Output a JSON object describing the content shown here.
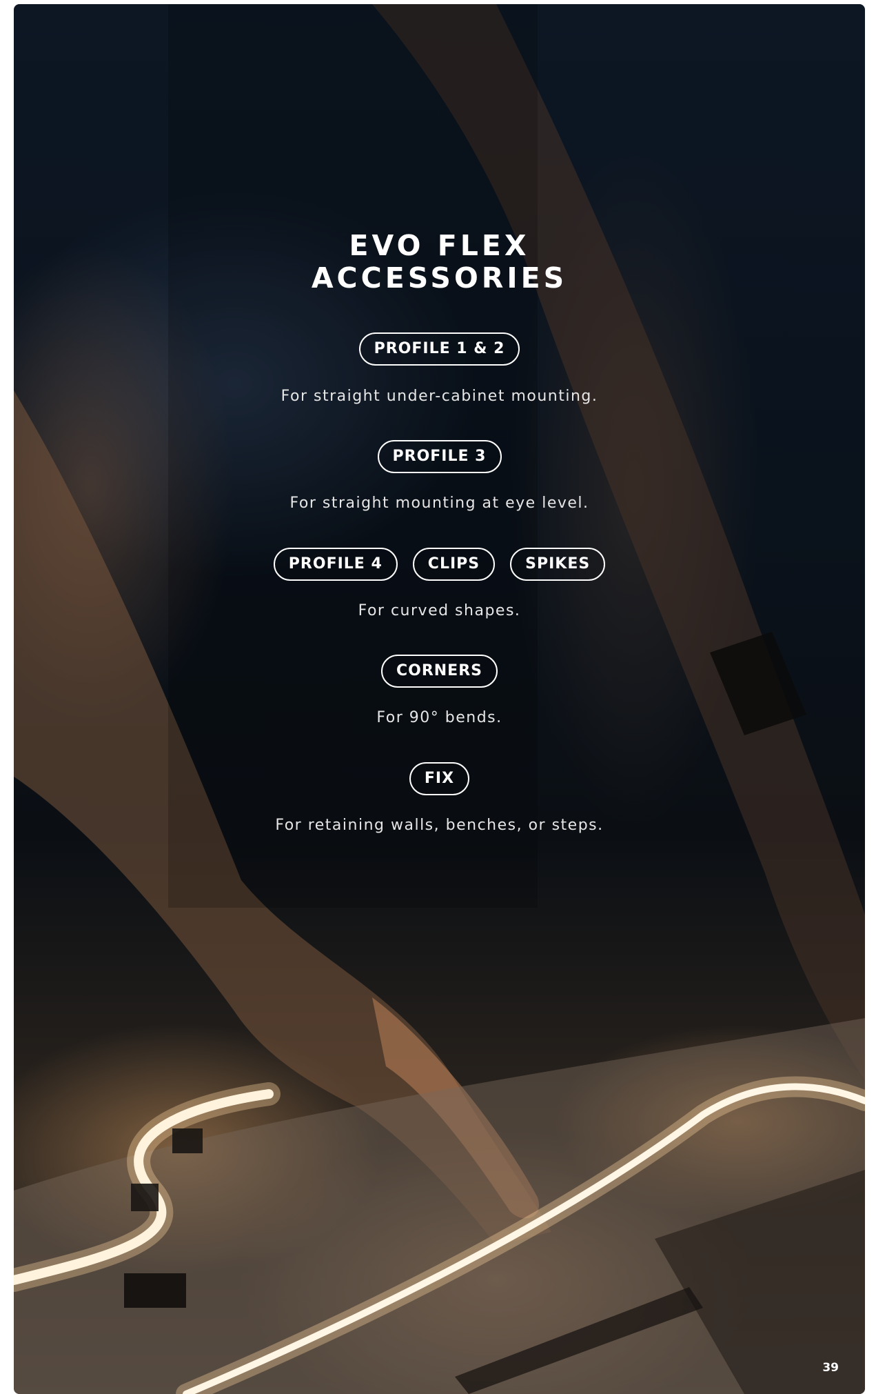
{
  "title": {
    "line1": "EVO FLEX",
    "line2": "ACCESSORIES"
  },
  "sections": [
    {
      "pills": [
        "PROFILE 1 & 2"
      ],
      "description": "For straight under-cabinet mounting."
    },
    {
      "pills": [
        "PROFILE 3"
      ],
      "description": "For straight mounting at eye level."
    },
    {
      "pills": [
        "PROFILE 4",
        "CLIPS",
        "SPIKES"
      ],
      "description": "For curved shapes."
    },
    {
      "pills": [
        "CORNERS"
      ],
      "description": "For 90° bends."
    },
    {
      "pills": [
        "FIX"
      ],
      "description": "For retaining walls, benches, or steps."
    }
  ],
  "page_number": "39"
}
